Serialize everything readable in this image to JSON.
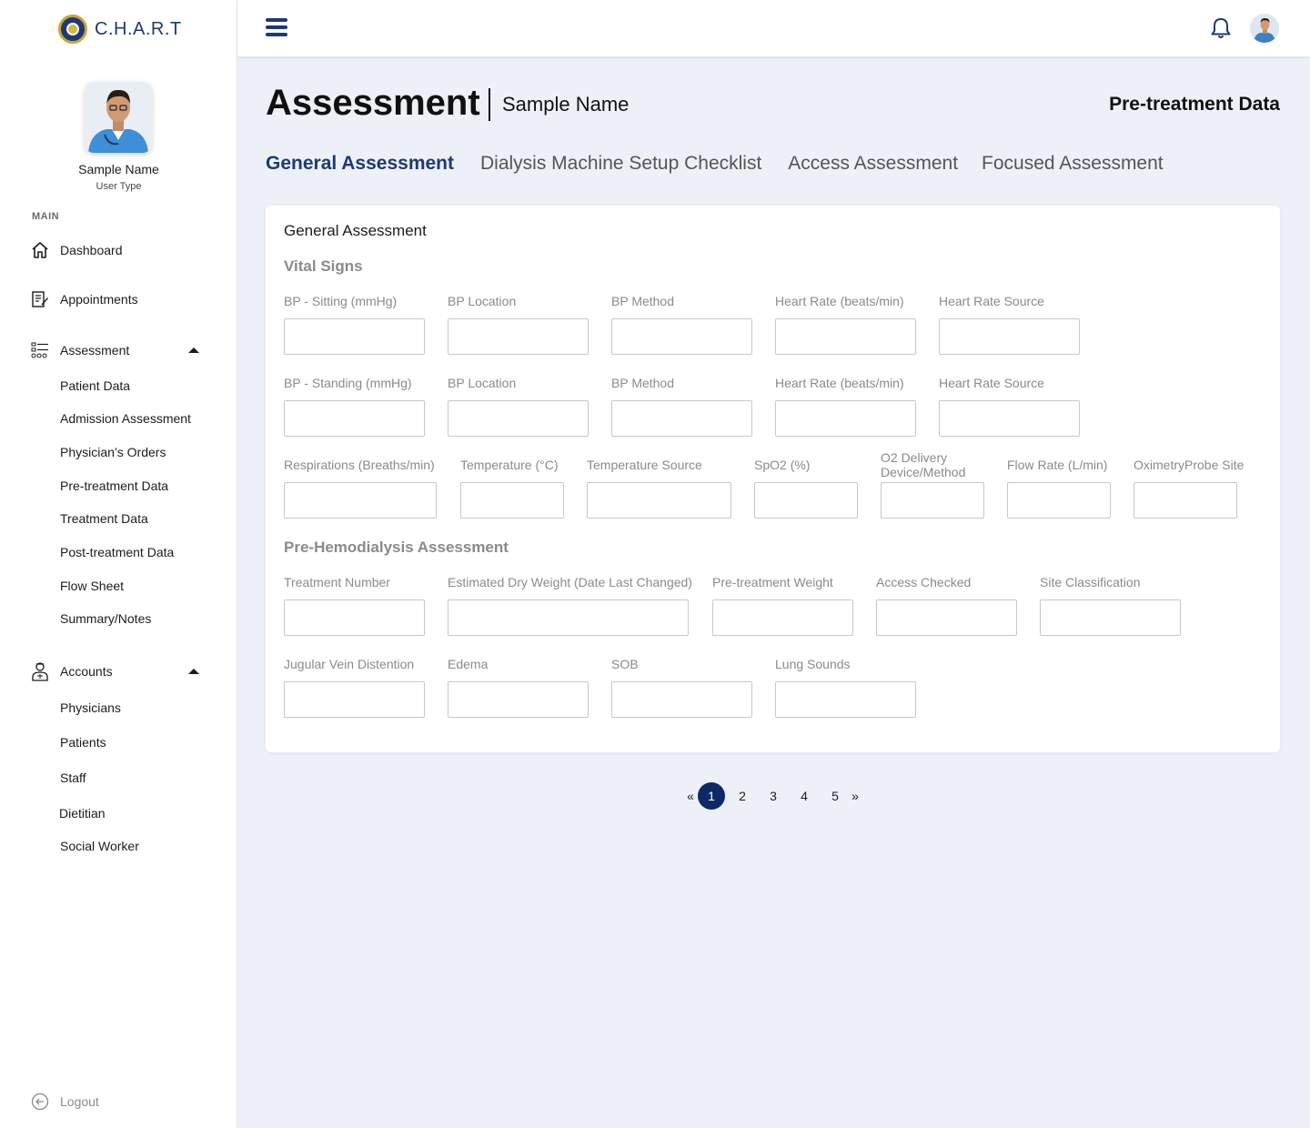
{
  "app": {
    "logo_text": "C.H.A.R.T"
  },
  "user": {
    "name": "Sample Name",
    "type": "User Type"
  },
  "sidebar": {
    "section_label": "MAIN",
    "dashboard": "Dashboard",
    "appointments": "Appointments",
    "assessment": "Assessment",
    "assessment_items": [
      "Patient Data",
      "Admission Assessment",
      "Physician’s Orders",
      "Pre-treatment Data",
      "Treatment Data",
      "Post-treatment Data",
      "Flow Sheet",
      "Summary/Notes"
    ],
    "accounts": "Accounts",
    "accounts_items": [
      "Physicians",
      "Patients",
      "Staff",
      "Dietitian",
      "Social Worker"
    ],
    "logout": "Logout"
  },
  "header": {
    "title": "Assessment",
    "subtitle": "Sample Name",
    "section": "Pre-treatment Data"
  },
  "tabs": [
    "General Assessment",
    "Dialysis Machine Setup Checklist",
    "Access Assessment",
    "Focused Assessment"
  ],
  "card": {
    "title": "General Assessment",
    "vital_signs": {
      "title": "Vital Signs",
      "row1": [
        "BP - Sitting (mmHg)",
        "BP Location",
        "BP Method",
        "Heart Rate (beats/min)",
        "Heart Rate Source"
      ],
      "row2": [
        "BP - Standing (mmHg)",
        "BP Location",
        "BP Method",
        "Heart Rate (beats/min)",
        "Heart Rate Source"
      ],
      "row3": [
        "Respirations (Breaths/min)",
        "Temperature (°C)",
        "Temperature Source",
        "SpO2 (%)",
        "O2 Delivery Device/Method",
        "Flow Rate (L/min)",
        "OximetryProbe Site"
      ]
    },
    "pre_hd": {
      "title": "Pre-Hemodialysis Assessment",
      "row1": [
        "Treatment Number",
        "Estimated Dry Weight (Date Last Changed)",
        "Pre-treatment Weight",
        "Access Checked",
        "Site Classification"
      ],
      "row2": [
        "Jugular Vein Distention",
        "Edema",
        "SOB",
        "Lung Sounds"
      ]
    }
  },
  "pagination": {
    "prev": "«",
    "pages": [
      "1",
      "2",
      "3",
      "4",
      "5"
    ],
    "next": "»",
    "current": "1"
  },
  "colors": {
    "primary": "#1e3a74",
    "pager_active": "#0d2a66",
    "background": "#eef0f7"
  }
}
